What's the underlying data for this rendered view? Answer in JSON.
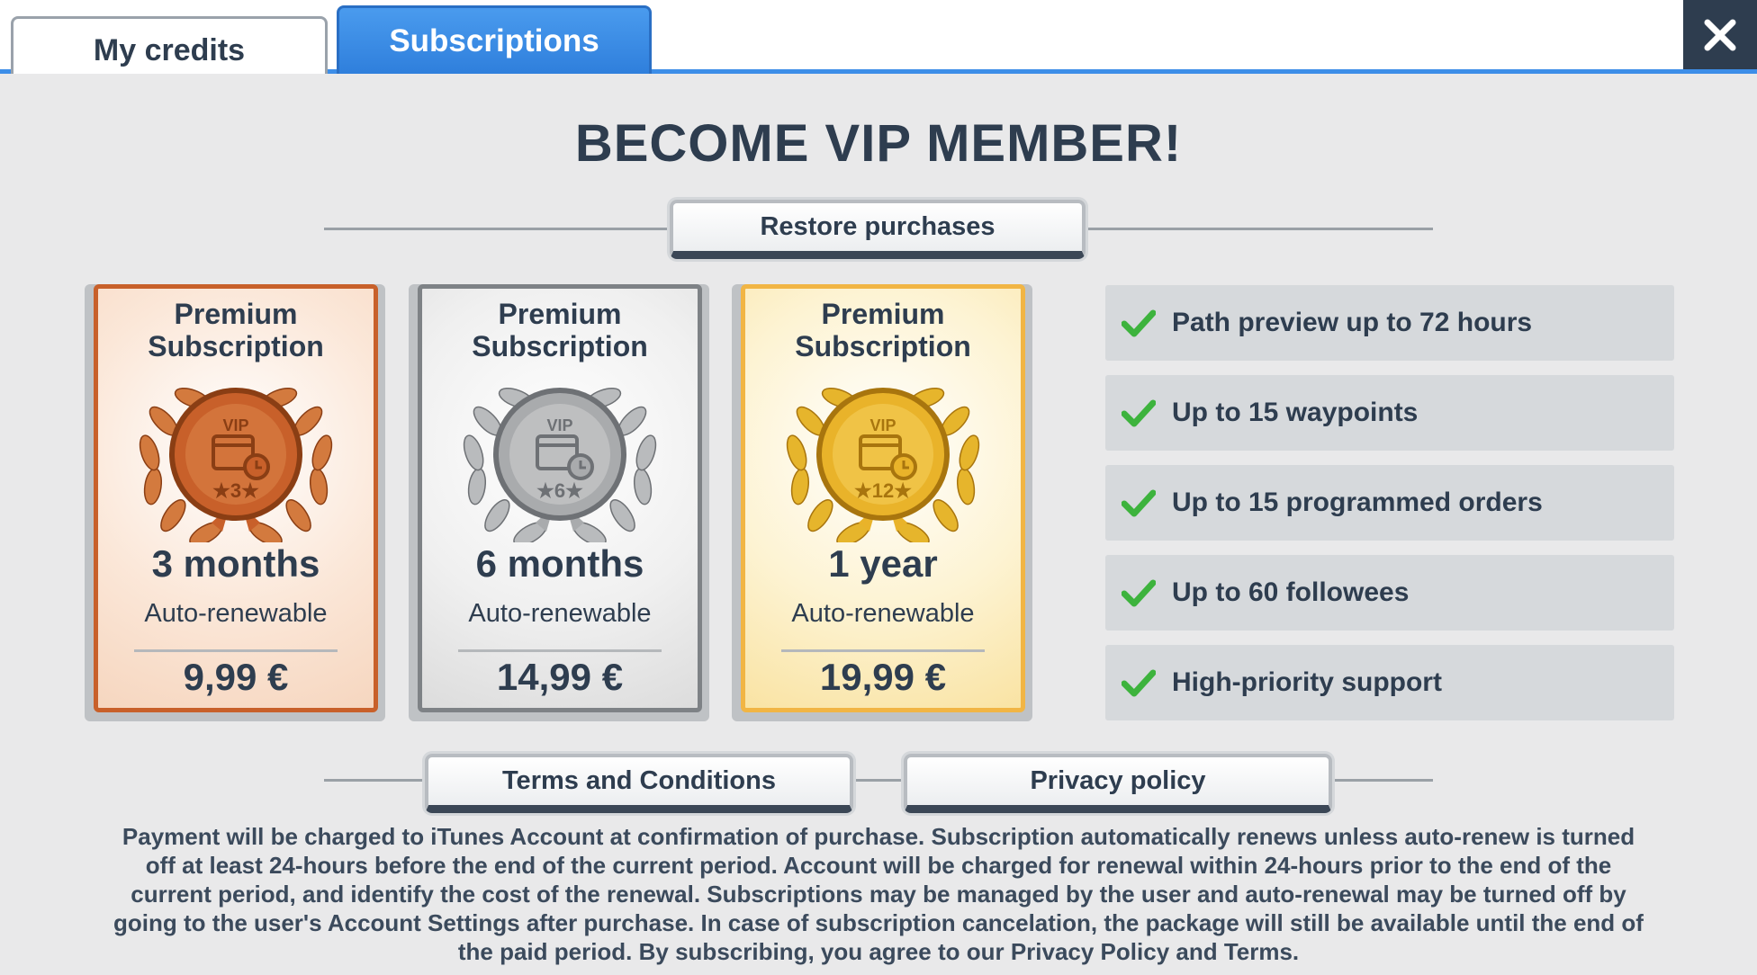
{
  "tabs": {
    "credits_label": "My credits",
    "subscriptions_label": "Subscriptions"
  },
  "close_icon": "close-icon",
  "heading": "BECOME VIP MEMBER!",
  "restore_label": "Restore purchases",
  "plans": [
    {
      "title_line1": "Premium",
      "title_line2": "Subscription",
      "medal_number": "3",
      "medal_text": "VIP",
      "duration": "3 months",
      "renewal": "Auto-renewable",
      "price": "9,99 €",
      "tier": "bronze",
      "color": "#c8602a"
    },
    {
      "title_line1": "Premium",
      "title_line2": "Subscription",
      "medal_number": "6",
      "medal_text": "VIP",
      "duration": "6 months",
      "renewal": "Auto-renewable",
      "price": "14,99 €",
      "tier": "silver",
      "color": "#8a8d90"
    },
    {
      "title_line1": "Premium",
      "title_line2": "Subscription",
      "medal_number": "12",
      "medal_text": "VIP",
      "duration": "1 year",
      "renewal": "Auto-renewable",
      "price": "19,99 €",
      "tier": "gold",
      "color": "#e9b32a"
    }
  ],
  "features": [
    "Path preview up to 72 hours",
    "Up to 15 waypoints",
    "Up to 15 programmed orders",
    "Up to 60 followees",
    "High-priority support"
  ],
  "terms_label": "Terms and Conditions",
  "privacy_label": "Privacy policy",
  "legal_lines": [
    "Payment will be charged to iTunes Account at confirmation of purchase. Subscription automatically renews unless auto-renew is turned",
    "off at least 24-hours before the end of the current period. Account will be charged for renewal within 24-hours prior to the end of the",
    "current period, and identify the cost of the renewal. Subscriptions may be managed by the user and auto-renewal may be turned off by",
    "going to the user's Account Settings after purchase. In case of subscription cancelation, the package will still be available until the end of",
    "the paid period. By subscribing, you agree to our Privacy Policy and Terms."
  ],
  "colors": {
    "accent": "#3d8ee8",
    "text": "#2e3d4f",
    "check": "#3db33d"
  }
}
